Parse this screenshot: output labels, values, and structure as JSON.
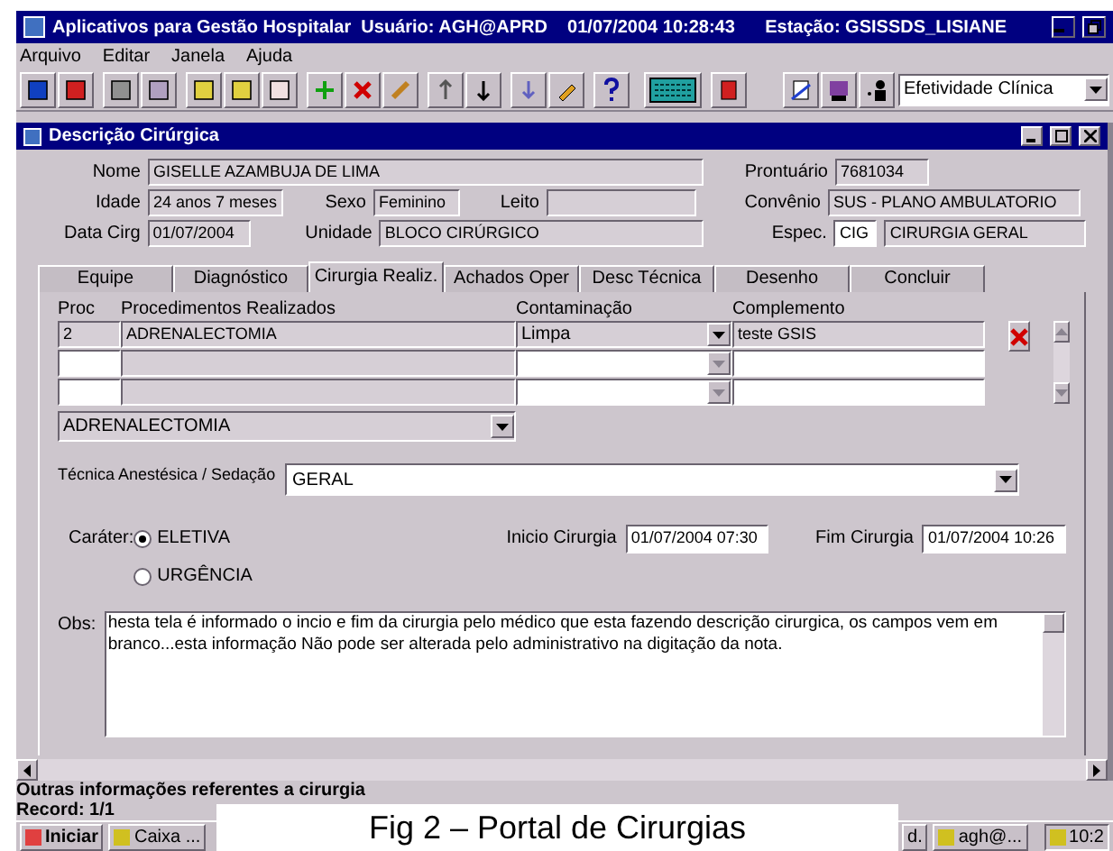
{
  "app_title": "Aplicativos para Gestão Hospitalar  Usuário: AGH@APRD    01/07/2004 10:28:43      Estação: GSISSDS_LISIANE",
  "menu": [
    "Arquivo",
    "Editar",
    "Janela",
    "Ajuda"
  ],
  "toolbar_combo": "Efetividade Clínica",
  "form_title": "Descrição Cirúrgica",
  "header": {
    "nome_label": "Nome",
    "nome": "GISELLE AZAMBUJA DE LIMA",
    "prontuario_label": "Prontuário",
    "prontuario": "7681034",
    "idade_label": "Idade",
    "idade": "24 anos 7 meses",
    "sexo_label": "Sexo",
    "sexo": "Feminino",
    "leito_label": "Leito",
    "convenio_label": "Convênio",
    "convenio": "SUS - PLANO AMBULATORIO",
    "data_label": "Data Cirg",
    "data": "01/07/2004",
    "unidade_label": "Unidade",
    "unidade": "BLOCO CIRÚRGICO",
    "espec_label": "Espec.",
    "espec_code": "CIG",
    "espec": "CIRURGIA GERAL"
  },
  "tabs": [
    {
      "label": "Equipe",
      "selected": false
    },
    {
      "label": "Diagnóstico",
      "selected": false
    },
    {
      "label": "Cirurgia Realiz.",
      "selected": true
    },
    {
      "label": "Achados Oper",
      "selected": false
    },
    {
      "label": "Desc Técnica",
      "selected": false
    },
    {
      "label": "Desenho",
      "selected": false
    },
    {
      "label": "Concluir",
      "selected": false
    }
  ],
  "grid": {
    "columns": [
      "Proc",
      "Procedimentos Realizados",
      "Contaminação",
      "Complemento"
    ],
    "rows": [
      {
        "proc": "2",
        "procedimento": "ADRENALECTOMIA",
        "contaminacao": "Limpa",
        "complemento": "teste GSIS"
      }
    ]
  },
  "procedure_combo": "ADRENALECTOMIA",
  "tecnica_label": "Técnica Anestésica / Sedação",
  "tecnica": "GERAL",
  "carater_label": "Caráter:",
  "carater": [
    {
      "label": "ELETIVA",
      "selected": true
    },
    {
      "label": "URGÊNCIA",
      "selected": false
    }
  ],
  "inicio_label": "Inicio Cirurgia",
  "inicio": "01/07/2004 07:30",
  "fim_label": "Fim Cirurgia",
  "fim": "01/07/2004 10:26",
  "obs_label": "Obs:",
  "obs": "hesta tela é informado o incio e fim da cirurgia pelo médico que esta fazendo descrição cirurgica, os campos vem em branco...esta informação Não pode ser alterada pelo administrativo na digitação da nota.",
  "status_bar": [
    "Outras informações referentes a cirurgia",
    "Record: 1/1"
  ],
  "taskbar": {
    "start": "Iniciar",
    "items": [
      "Caixa ...",
      "d.",
      "agh@..."
    ],
    "clock": "10:2"
  },
  "caption": "Fig 2 – Portal de Cirurgias"
}
